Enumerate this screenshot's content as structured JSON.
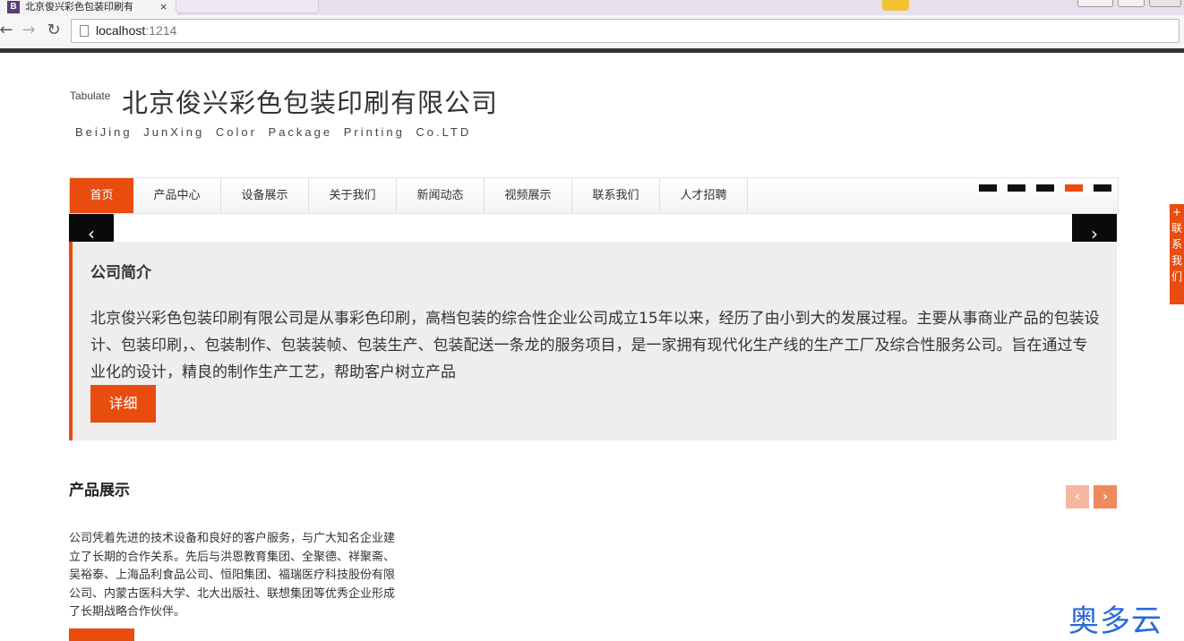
{
  "browser": {
    "tab_title": "北京俊兴彩色包装印刷有",
    "tab_close": "×",
    "favicon": "B",
    "back_icon": "←",
    "forward_icon": "→",
    "reload_icon": "↻",
    "url_host": "localhost",
    "url_port": ":1214"
  },
  "header": {
    "tag": "Tabulate",
    "title": "北京俊兴彩色包装印刷有限公司",
    "subtitle": "BeiJing JunXing Color Package Printing Co.LTD"
  },
  "nav": {
    "items": [
      {
        "label": "首页",
        "active": true
      },
      {
        "label": "产品中心",
        "active": false
      },
      {
        "label": "设备展示",
        "active": false
      },
      {
        "label": "关于我们",
        "active": false
      },
      {
        "label": "新闻动态",
        "active": false
      },
      {
        "label": "视频展示",
        "active": false
      },
      {
        "label": "联系我们",
        "active": false
      },
      {
        "label": "人才招聘",
        "active": false
      }
    ],
    "slider_dots": 5,
    "active_dot": 4
  },
  "slider": {
    "prev_icon": "‹",
    "next_icon": "›"
  },
  "intro": {
    "title": "公司简介",
    "body": "北京俊兴彩色包装印刷有限公司是从事彩色印刷，高档包装的综合性企业公司成立15年以来，经历了由小到大的发展过程。主要从事商业产品的包装设计、包装印刷，、包装制作、包装装帧、包装生产、包装配送一条龙的服务项目，是一家拥有现代化生产线的生产工厂及综合性服务公司。旨在通过专业化的设计，精良的制作生产工艺，帮助客户树立产品",
    "button": "详细"
  },
  "products": {
    "title": "产品展示",
    "prev_icon": "‹",
    "next_icon": "›",
    "body": "公司凭着先进的技术设备和良好的客户服务，与广大知名企业建立了长期的合作关系。先后与洪恩教育集团、全聚德、祥聚斋、吴裕泰、上海品利食品公司、恒阳集团、福瑞医疗科技股份有限公司、内蒙古医科大学、北大出版社、联想集团等优秀企业形成了长期战略合作伙伴。"
  },
  "float_tab": {
    "chars": [
      "+",
      "联",
      "系",
      "我",
      "们"
    ]
  },
  "watermark": "奥多云",
  "colors": {
    "accent": "#e84c0e",
    "panel": "#eeeeee",
    "dark": "#0a0a0a"
  }
}
